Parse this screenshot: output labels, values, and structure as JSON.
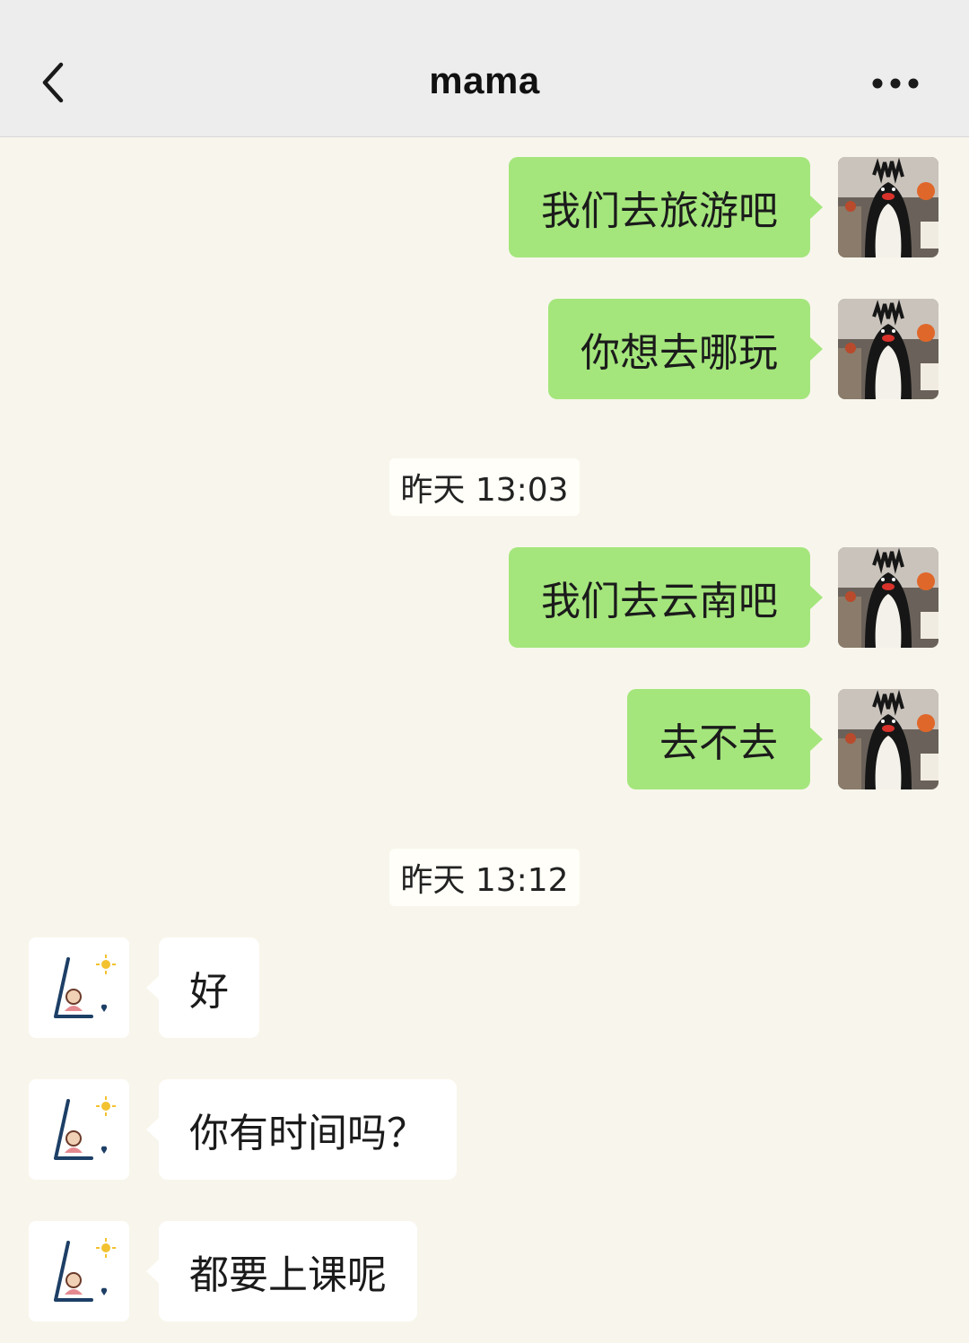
{
  "header": {
    "title": "mama",
    "back_icon": "chevron-left-icon",
    "more_icon": "more-dots-icon"
  },
  "messages": [
    {
      "side": "out",
      "text": "我们去旅游吧"
    },
    {
      "side": "out",
      "text": "你想去哪玩"
    },
    {
      "type": "timestamp",
      "text": "昨天 13:03"
    },
    {
      "side": "out",
      "text": "我们去云南吧"
    },
    {
      "side": "out",
      "text": "去不去"
    },
    {
      "type": "timestamp",
      "text": "昨天 13:12"
    },
    {
      "side": "in",
      "text": "好"
    },
    {
      "side": "in",
      "text": "你有时间吗？"
    },
    {
      "side": "in",
      "text": "都要上课呢"
    }
  ],
  "colors": {
    "header_bg": "#ededed",
    "chat_bg": "#f8f6ec",
    "outgoing_bubble": "#a4e67c",
    "incoming_bubble": "#ffffff"
  }
}
